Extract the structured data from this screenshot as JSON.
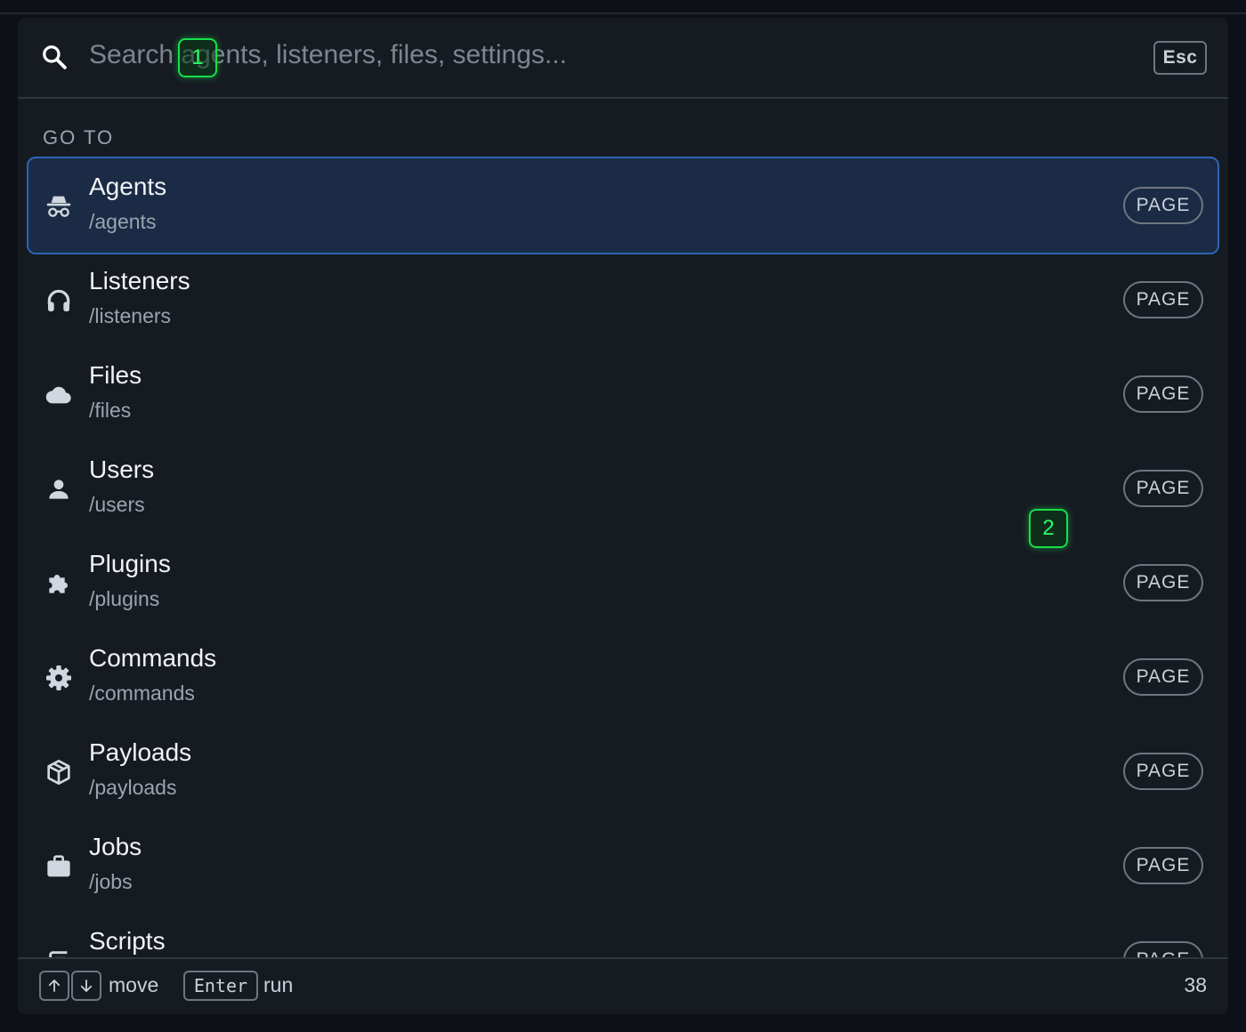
{
  "search": {
    "placeholder": "Search agents, listeners, files, settings...",
    "value": "",
    "esc_label": "Esc"
  },
  "section": {
    "label": "GO TO"
  },
  "items": [
    {
      "title": "Agents",
      "path": "/agents",
      "badge": "PAGE",
      "icon": "incognito-icon",
      "selected": true
    },
    {
      "title": "Listeners",
      "path": "/listeners",
      "badge": "PAGE",
      "icon": "headphones-icon"
    },
    {
      "title": "Files",
      "path": "/files",
      "badge": "PAGE",
      "icon": "cloud-icon"
    },
    {
      "title": "Users",
      "path": "/users",
      "badge": "PAGE",
      "icon": "user-icon"
    },
    {
      "title": "Plugins",
      "path": "/plugins",
      "badge": "PAGE",
      "icon": "puzzle-icon"
    },
    {
      "title": "Commands",
      "path": "/commands",
      "badge": "PAGE",
      "icon": "gear-icon"
    },
    {
      "title": "Payloads",
      "path": "/payloads",
      "badge": "PAGE",
      "icon": "package-icon"
    },
    {
      "title": "Jobs",
      "path": "/jobs",
      "badge": "PAGE",
      "icon": "briefcase-icon"
    },
    {
      "title": "Scripts",
      "path": "",
      "badge": "PAGE",
      "icon": "script-icon"
    }
  ],
  "footer": {
    "move_label": "move",
    "enter_key": "Enter",
    "run_label": "run",
    "count": "38"
  },
  "markers": [
    "1",
    "2"
  ],
  "colors": {
    "background": "#0d1117",
    "panel": "#161b22",
    "selected": "#1b2b45",
    "selected_border": "#2c64b3",
    "marker": "#16e04a"
  }
}
